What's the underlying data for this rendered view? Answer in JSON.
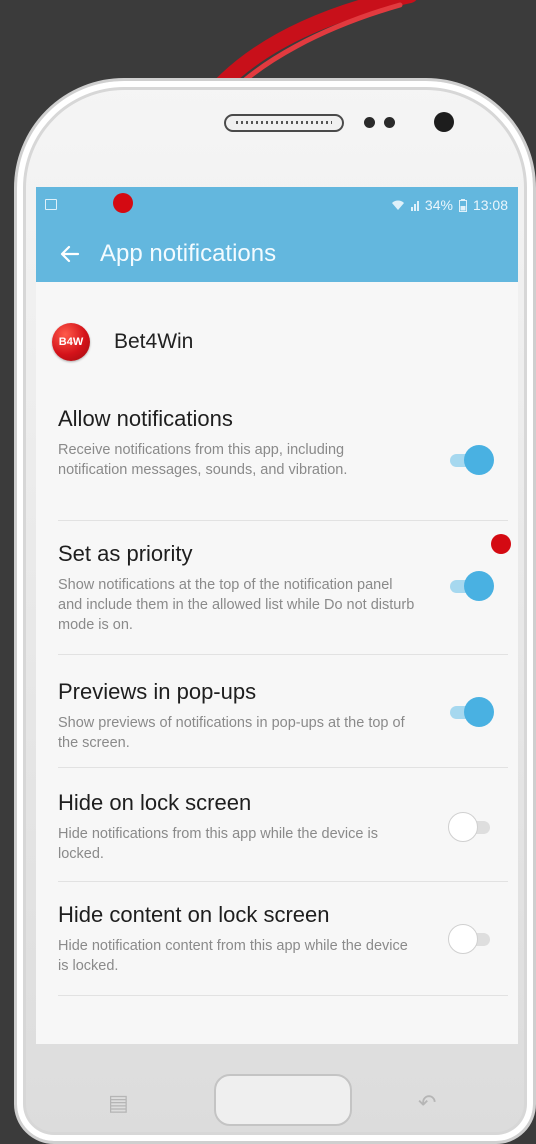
{
  "status_bar": {
    "battery": "34%",
    "time": "13:08"
  },
  "app_bar": {
    "back_icon": "arrow-left-icon",
    "title": "App notifications"
  },
  "app": {
    "icon_text": "B4W",
    "name": "Bet4Win"
  },
  "settings": [
    {
      "title": "Allow notifications",
      "description": "Receive notifications from this app, including notification messages, sounds, and vibration.",
      "enabled": true
    },
    {
      "title": "Set as priority",
      "description": "Show notifications at the top of the notification panel and include them in the allowed list while Do not disturb mode is on.",
      "enabled": true
    },
    {
      "title": "Previews in pop-ups",
      "description": "Show previews of notifications in pop-ups at the top of the screen.",
      "enabled": true
    },
    {
      "title": "Hide on lock screen",
      "description": "Hide notifications from this app while the device is locked.",
      "enabled": false
    },
    {
      "title": "Hide content on lock screen",
      "description": "Hide notification content from this app while the device is locked.",
      "enabled": false
    }
  ],
  "colors": {
    "accent": "#63b7de",
    "toggle_on": "#49b1e2",
    "marker": "#d40a12"
  }
}
